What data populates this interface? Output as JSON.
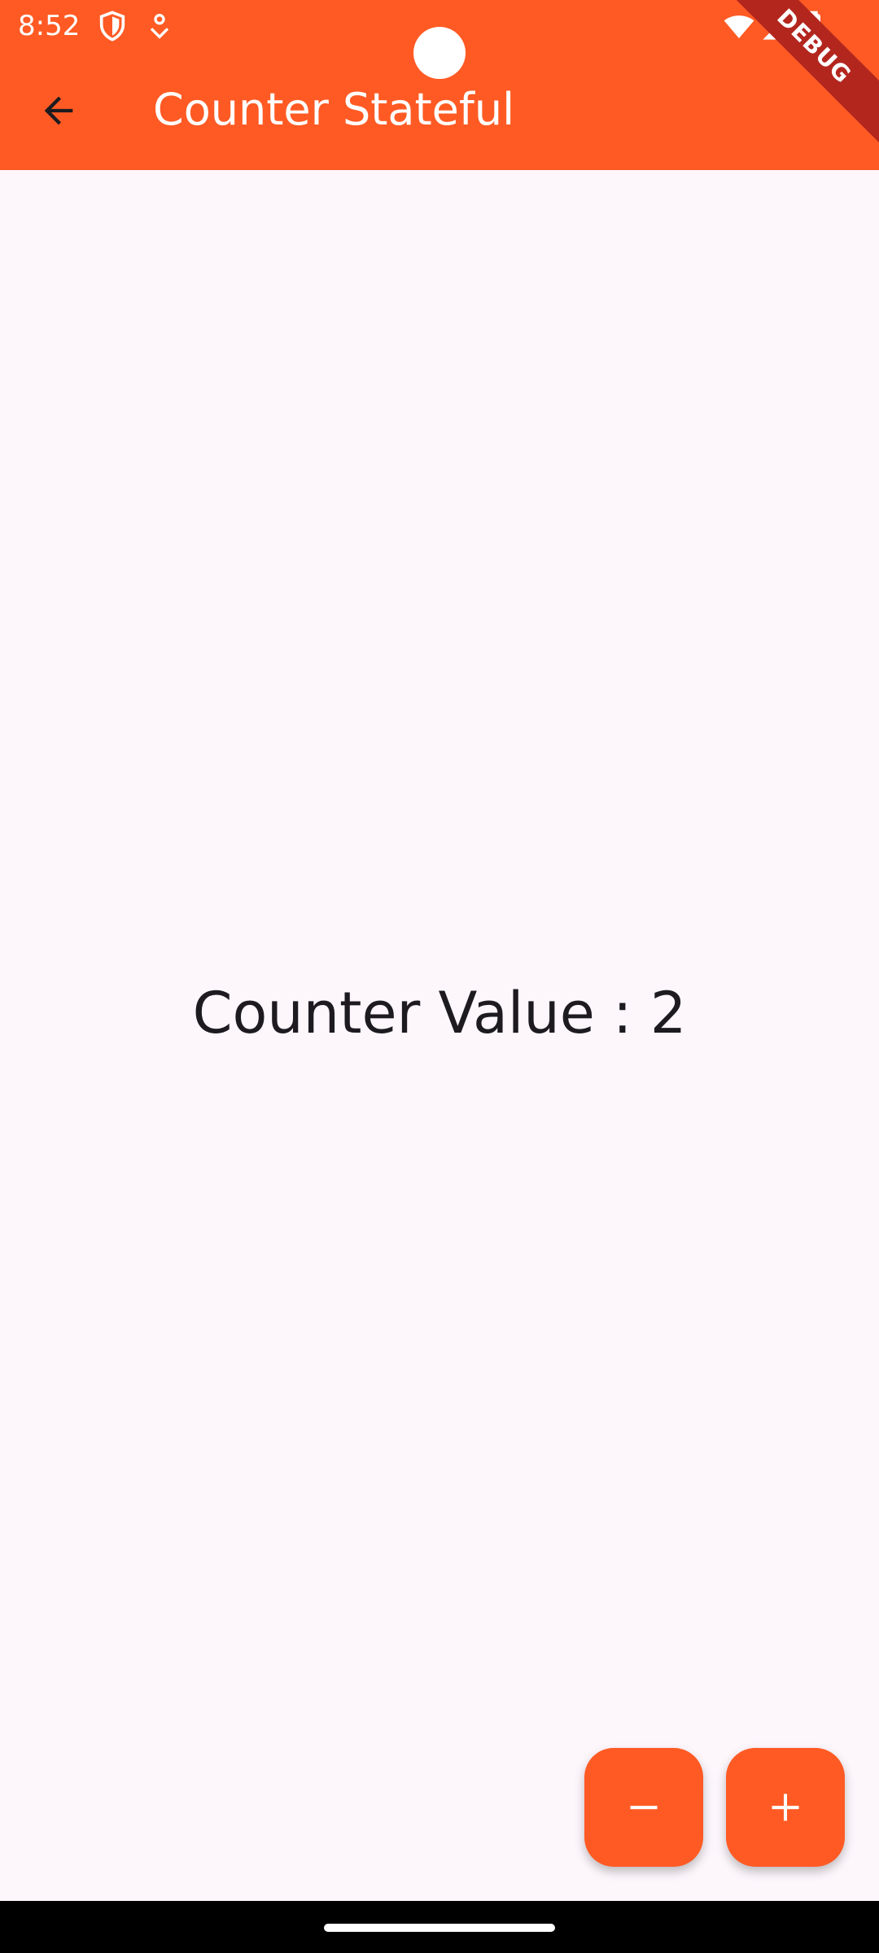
{
  "status_bar": {
    "time": "8:52"
  },
  "app_bar": {
    "title": "Counter Stateful",
    "back_icon": "arrow-back-icon"
  },
  "debug_banner": "DEBUG",
  "main": {
    "counter_text": "Counter Value : 2"
  },
  "fabs": [
    {
      "icon": "minus-icon"
    },
    {
      "icon": "plus-icon"
    }
  ],
  "colors": {
    "primary": "#FF5A24",
    "background": "#FDF7FC",
    "text": "#1D1B20",
    "debug": "#B3261E"
  }
}
